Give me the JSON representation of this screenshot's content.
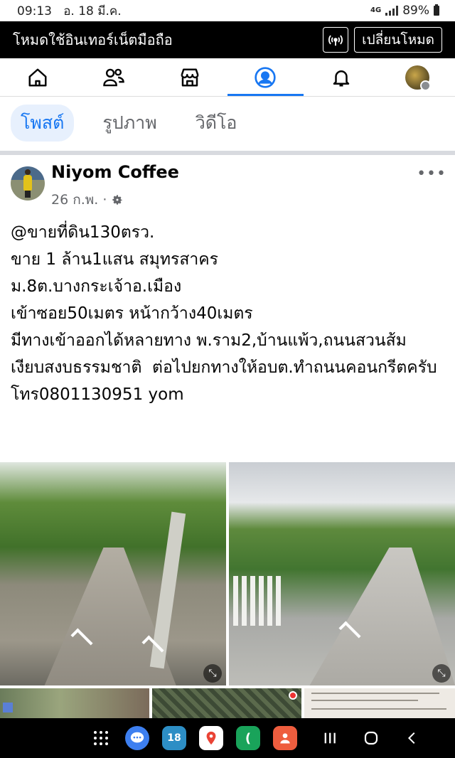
{
  "status_bar": {
    "time": "09:13",
    "date": "อ. 18 มี.ค.",
    "network": "4G",
    "battery": "89%"
  },
  "data_banner": {
    "title": "โหมดใช้อินเทอร์เน็ตมือถือ",
    "switch_label": "เปลี่ยนโหมด"
  },
  "nav": {
    "items": [
      "home-icon",
      "friends-icon",
      "marketplace-icon",
      "profile-icon",
      "notifications-icon",
      "account-avatar"
    ],
    "active_index": 3,
    "accent": "#1877f2"
  },
  "filters": {
    "items": [
      "โพสต์",
      "รูปภาพ",
      "วิดีโอ"
    ],
    "active": "โพสต์"
  },
  "post": {
    "author": "Niyom Coffee",
    "date": "26 ก.พ.",
    "separator": "·",
    "lines": [
      "@ขายที่ดิน130ตรว.",
      "ขาย 1 ล้าน1แสน สมุทรสาคร",
      "ม.8ต.บางกระเจ้าอ.เมือง",
      "เข้าซอย50เมตร หน้ากว้าง40เมตร",
      "มีทางเข้าออกได้หลายทาง พ.ราม2,บ้านแพ้ว,ถนนสวนส้ม",
      "เงียบสงบธรรมชาติ  ต่อไปยกทางให้อบต.ทำถนนคอนกรีตครับ",
      "โทร0801130951 yom"
    ]
  },
  "dock": {
    "apps": [
      "messages-icon",
      "calendar-icon",
      "maps-icon",
      "line-icon",
      "contacts-icon"
    ],
    "calendar_day": "18"
  }
}
